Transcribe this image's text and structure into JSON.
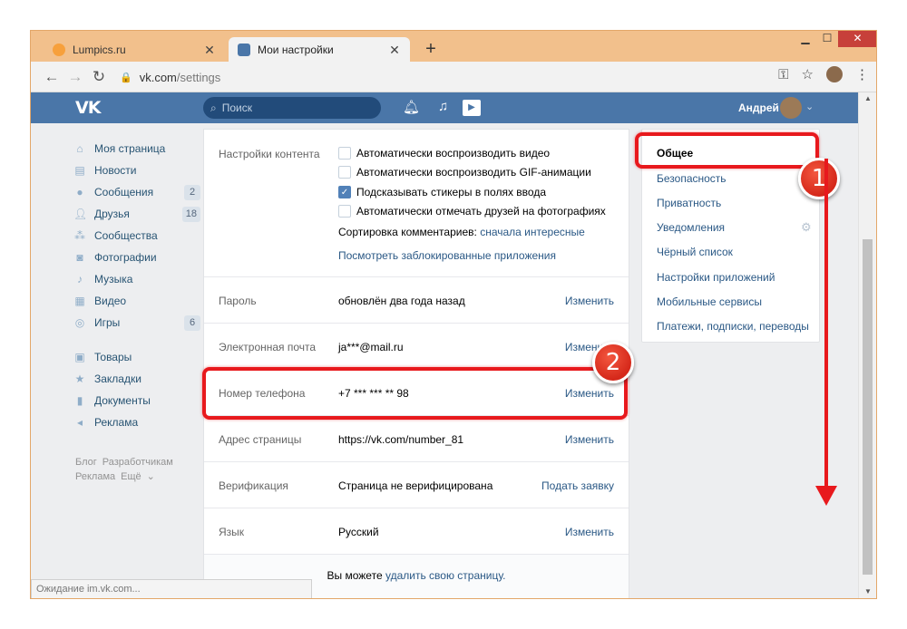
{
  "browser": {
    "tabs": [
      {
        "title": "Lumpics.ru",
        "active": false,
        "favicon_color": "#f7a03c"
      },
      {
        "title": "Мои настройки",
        "active": true,
        "favicon_color": "#4a76a8"
      }
    ],
    "address": {
      "host": "vk.com",
      "path": "/settings"
    },
    "status_text": "Ожидание im.vk.com..."
  },
  "vk": {
    "logo": "VK",
    "search_placeholder": "Поиск",
    "user_name": "Андрей",
    "left_nav": [
      {
        "label": "Моя страница",
        "icon": "home-icon",
        "count": ""
      },
      {
        "label": "Новости",
        "icon": "news-icon",
        "count": ""
      },
      {
        "label": "Сообщения",
        "icon": "messages-icon",
        "count": "2"
      },
      {
        "label": "Друзья",
        "icon": "friends-icon",
        "count": "18"
      },
      {
        "label": "Сообщества",
        "icon": "groups-icon",
        "count": ""
      },
      {
        "label": "Фотографии",
        "icon": "camera-icon",
        "count": ""
      },
      {
        "label": "Музыка",
        "icon": "music-icon",
        "count": ""
      },
      {
        "label": "Видео",
        "icon": "video-icon",
        "count": ""
      },
      {
        "label": "Игры",
        "icon": "games-icon",
        "count": "6"
      }
    ],
    "left_nav_2": [
      {
        "label": "Товары",
        "icon": "bag-icon"
      },
      {
        "label": "Закладки",
        "icon": "star-icon"
      },
      {
        "label": "Документы",
        "icon": "document-icon"
      },
      {
        "label": "Реклама",
        "icon": "ads-icon"
      }
    ],
    "footer_links": {
      "blog": "Блог",
      "devs": "Разработчикам",
      "ads": "Реклама",
      "more": "Ещё"
    }
  },
  "settings": {
    "content_label": "Настройки контента",
    "options": [
      {
        "label": "Автоматически воспроизводить видео",
        "checked": false
      },
      {
        "label": "Автоматически воспроизводить GIF-анимации",
        "checked": false
      },
      {
        "label": "Подсказывать стикеры в полях ввода",
        "checked": true
      },
      {
        "label": "Автоматически отмечать друзей на фотографиях",
        "checked": false
      }
    ],
    "comments_sort_label": "Сортировка комментариев:",
    "comments_sort_value": "сначала интересные",
    "blocked_apps_link": "Посмотреть заблокированные приложения",
    "rows": [
      {
        "label": "Пароль",
        "value": "обновлён два года назад",
        "action": "Изменить"
      },
      {
        "label": "Электронная почта",
        "value": "ja***@mail.ru",
        "action": "Изменить"
      },
      {
        "label": "Номер телефона",
        "value": "+7 *** *** ** 98",
        "action": "Изменить"
      },
      {
        "label": "Адрес страницы",
        "value": "https://vk.com/number_81",
        "action": "Изменить"
      },
      {
        "label": "Верификация",
        "value": "Страница не верифицирована",
        "action": "Подать заявку"
      },
      {
        "label": "Язык",
        "value": "Русский",
        "action": "Изменить"
      }
    ],
    "delete_prefix": "Вы можете",
    "delete_link": "удалить свою страницу."
  },
  "right_menu": [
    {
      "label": "Общее",
      "selected": true
    },
    {
      "label": "Безопасность",
      "selected": false
    },
    {
      "label": "Приватность",
      "selected": false
    },
    {
      "label": "Уведомления",
      "selected": false
    },
    {
      "label": "Чёрный список",
      "selected": false
    },
    {
      "label": "Настройки приложений",
      "selected": false
    },
    {
      "label": "Мобильные сервисы",
      "selected": false
    },
    {
      "label": "Платежи, подписки, переводы",
      "selected": false
    }
  ],
  "annotations": {
    "badge1": "1",
    "badge2": "2",
    "color": "#e8191d"
  }
}
